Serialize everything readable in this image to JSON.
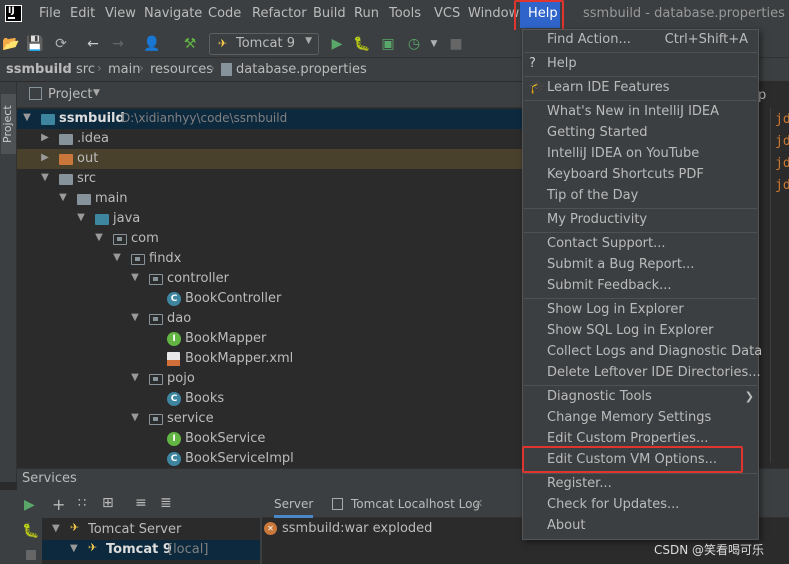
{
  "menubar": {
    "logo": "IJ",
    "items": [
      "File",
      "Edit",
      "View",
      "Navigate",
      "Code",
      "Refactor",
      "Build",
      "Run",
      "Tools",
      "VCS",
      "Window"
    ],
    "help": "Help",
    "window_title": "ssmbuild - database.properties"
  },
  "toolbar": {
    "run_config": "Tomcat 9"
  },
  "breadcrumb": [
    "ssmbuild",
    "src",
    "main",
    "resources",
    "database.properties"
  ],
  "project": {
    "title": "Project",
    "root_name": "ssmbuild",
    "root_path": "D:\\xidianhyy\\code\\ssmbuild",
    "items": [
      {
        "label": "ssmbuild"
      },
      {
        "label": ".idea"
      },
      {
        "label": "out"
      },
      {
        "label": "src"
      },
      {
        "label": "main"
      },
      {
        "label": "java"
      },
      {
        "label": "com"
      },
      {
        "label": "findx"
      },
      {
        "label": "controller"
      },
      {
        "label": "BookController"
      },
      {
        "label": "dao"
      },
      {
        "label": "BookMapper"
      },
      {
        "label": "BookMapper.xml"
      },
      {
        "label": "pojo"
      },
      {
        "label": "Books"
      },
      {
        "label": "service"
      },
      {
        "label": "BookService"
      },
      {
        "label": "BookServiceImpl"
      }
    ],
    "side_tab": "Project"
  },
  "editor": {
    "lines": [
      "jd",
      "jd",
      "jd",
      "jd"
    ]
  },
  "services": {
    "title": "Services",
    "server": "Tomcat Server",
    "instance": "Tomcat 9",
    "instance_suffix": "[local]",
    "tabs": [
      "Server",
      "Tomcat Localhost Log"
    ],
    "output": "ssmbuild:war exploded"
  },
  "help_menu": {
    "items": [
      {
        "label": "Find Action...",
        "shortcut": "Ctrl+Shift+A"
      },
      {
        "label": "Help"
      },
      {
        "label": "Learn IDE Features"
      },
      {
        "label": "What's New in IntelliJ IDEA"
      },
      {
        "label": "Getting Started"
      },
      {
        "label": "IntelliJ IDEA on YouTube"
      },
      {
        "label": "Keyboard Shortcuts PDF"
      },
      {
        "label": "Tip of the Day"
      },
      {
        "label": "My Productivity"
      },
      {
        "label": "Contact Support..."
      },
      {
        "label": "Submit a Bug Report..."
      },
      {
        "label": "Submit Feedback..."
      },
      {
        "label": "Show Log in Explorer"
      },
      {
        "label": "Show SQL Log in Explorer"
      },
      {
        "label": "Collect Logs and Diagnostic Data"
      },
      {
        "label": "Delete Leftover IDE Directories..."
      },
      {
        "label": "Diagnostic Tools"
      },
      {
        "label": "Change Memory Settings"
      },
      {
        "label": "Edit Custom Properties..."
      },
      {
        "label": "Edit Custom VM Options..."
      },
      {
        "label": "Register..."
      },
      {
        "label": "Check for Updates..."
      },
      {
        "label": "About"
      }
    ],
    "partial_label": "p"
  },
  "watermark": "CSDN @笑看喝可乐",
  "colors": {
    "menu_highlight": "#2f65ca",
    "annotation_red": "#e0342f",
    "selection": "#0d293e"
  }
}
